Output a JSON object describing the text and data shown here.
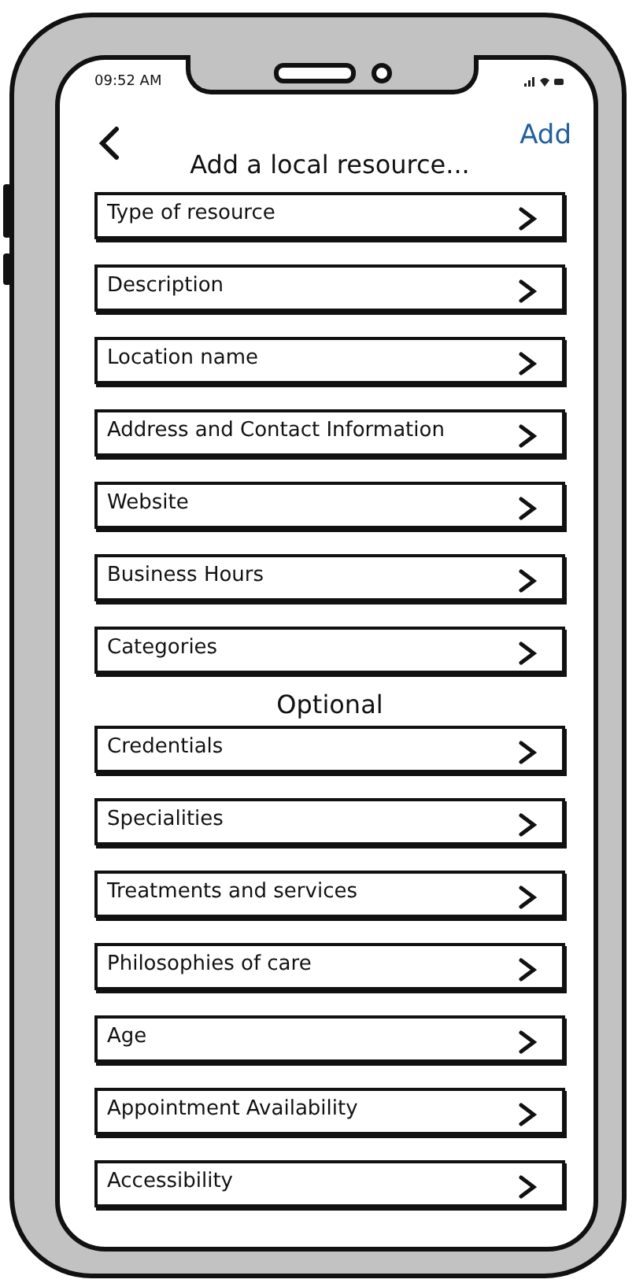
{
  "status_bar": {
    "time": "09:52 AM"
  },
  "header": {
    "action": "Add",
    "title": "Add a local resource..."
  },
  "fields": [
    {
      "label": "Type of resource"
    },
    {
      "label": "Description"
    },
    {
      "label": "Location name"
    },
    {
      "label": "Address and Contact Information"
    },
    {
      "label": "Website"
    },
    {
      "label": "Business Hours"
    },
    {
      "label": "Categories"
    }
  ],
  "optional": {
    "heading": "Optional",
    "fields": [
      {
        "label": "Credentials"
      },
      {
        "label": "Specialities"
      },
      {
        "label": "Treatments and services"
      },
      {
        "label": "Philosophies of care"
      },
      {
        "label": "Age"
      },
      {
        "label": "Appointment Availability"
      },
      {
        "label": "Accessibility"
      }
    ]
  }
}
